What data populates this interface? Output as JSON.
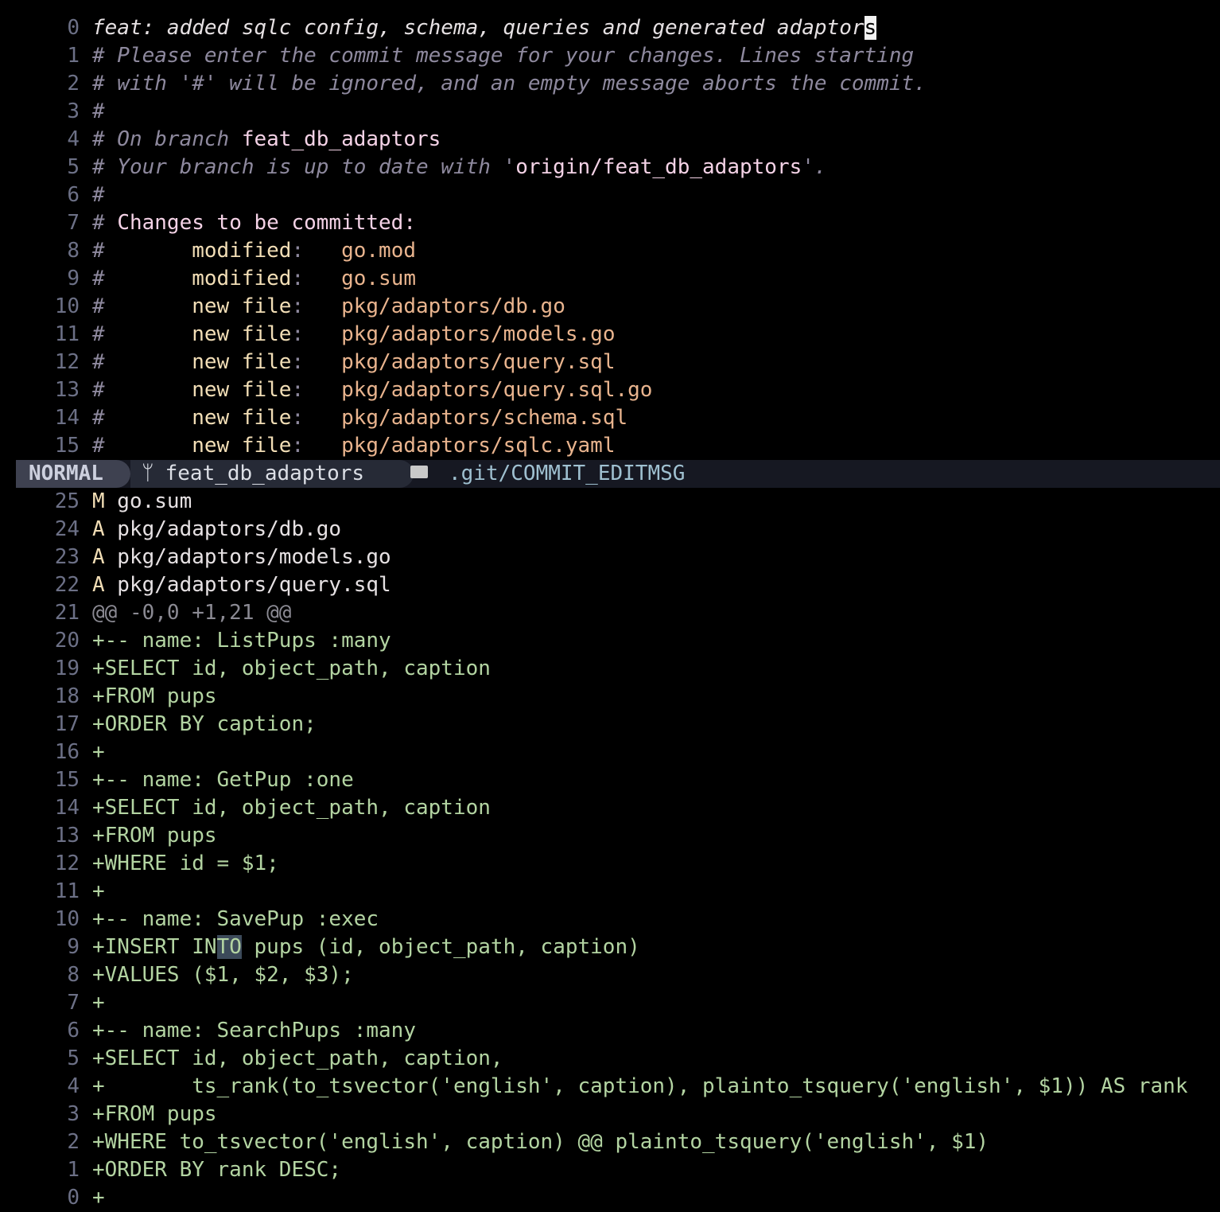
{
  "top_lines": [
    {
      "n": "0",
      "segs": [
        {
          "t": "feat: added sqlc config, schema, queries and generated adaptor",
          "c": "c-white it"
        },
        {
          "t": "s",
          "c": "cursor"
        }
      ]
    },
    {
      "n": "1",
      "segs": [
        {
          "t": "# Please enter the commit message for your changes. Lines starting",
          "c": "c-comment it"
        }
      ]
    },
    {
      "n": "2",
      "segs": [
        {
          "t": "# with '#' will be ignored, and an empty message aborts the commit.",
          "c": "c-comment it"
        }
      ]
    },
    {
      "n": "3",
      "segs": [
        {
          "t": "#",
          "c": "c-comment it"
        }
      ]
    },
    {
      "n": "4",
      "segs": [
        {
          "t": "# On branch ",
          "c": "c-comment it"
        },
        {
          "t": "feat_db_adaptors",
          "c": "c-pink"
        }
      ]
    },
    {
      "n": "5",
      "segs": [
        {
          "t": "# Your branch is up to date with '",
          "c": "c-comment it"
        },
        {
          "t": "origin/feat_db_adaptors",
          "c": "c-pink"
        },
        {
          "t": "'.",
          "c": "c-comment it"
        }
      ]
    },
    {
      "n": "6",
      "segs": [
        {
          "t": "#",
          "c": "c-comment it"
        }
      ]
    },
    {
      "n": "7",
      "segs": [
        {
          "t": "# ",
          "c": "c-comment it"
        },
        {
          "t": "Changes to be committed:",
          "c": "c-pink"
        }
      ]
    },
    {
      "n": "8",
      "segs": [
        {
          "t": "#       ",
          "c": "c-comment it"
        },
        {
          "t": "modified",
          "c": "c-yellow"
        },
        {
          "t": ":   ",
          "c": "c-comment"
        },
        {
          "t": "go.mod",
          "c": "c-orange"
        }
      ]
    },
    {
      "n": "9",
      "segs": [
        {
          "t": "#       ",
          "c": "c-comment it"
        },
        {
          "t": "modified",
          "c": "c-yellow"
        },
        {
          "t": ":   ",
          "c": "c-comment"
        },
        {
          "t": "go.sum",
          "c": "c-orange"
        }
      ]
    },
    {
      "n": "10",
      "segs": [
        {
          "t": "#       ",
          "c": "c-comment it"
        },
        {
          "t": "new file",
          "c": "c-yellow"
        },
        {
          "t": ":   ",
          "c": "c-comment"
        },
        {
          "t": "pkg/adaptors/db.go",
          "c": "c-orange"
        }
      ]
    },
    {
      "n": "11",
      "segs": [
        {
          "t": "#       ",
          "c": "c-comment it"
        },
        {
          "t": "new file",
          "c": "c-yellow"
        },
        {
          "t": ":   ",
          "c": "c-comment"
        },
        {
          "t": "pkg/adaptors/models.go",
          "c": "c-orange"
        }
      ]
    },
    {
      "n": "12",
      "segs": [
        {
          "t": "#       ",
          "c": "c-comment it"
        },
        {
          "t": "new file",
          "c": "c-yellow"
        },
        {
          "t": ":   ",
          "c": "c-comment"
        },
        {
          "t": "pkg/adaptors/query.sql",
          "c": "c-orange"
        }
      ]
    },
    {
      "n": "13",
      "segs": [
        {
          "t": "#       ",
          "c": "c-comment it"
        },
        {
          "t": "new file",
          "c": "c-yellow"
        },
        {
          "t": ":   ",
          "c": "c-comment"
        },
        {
          "t": "pkg/adaptors/query.sql.go",
          "c": "c-orange"
        }
      ]
    },
    {
      "n": "14",
      "segs": [
        {
          "t": "#       ",
          "c": "c-comment it"
        },
        {
          "t": "new file",
          "c": "c-yellow"
        },
        {
          "t": ":   ",
          "c": "c-comment"
        },
        {
          "t": "pkg/adaptors/schema.sql",
          "c": "c-orange"
        }
      ]
    },
    {
      "n": "15",
      "segs": [
        {
          "t": "#       ",
          "c": "c-comment it"
        },
        {
          "t": "new file",
          "c": "c-yellow"
        },
        {
          "t": ":   ",
          "c": "c-comment"
        },
        {
          "t": "pkg/adaptors/sqlc.yaml",
          "c": "c-orange"
        }
      ]
    }
  ],
  "statusline": {
    "mode": "NORMAL",
    "branch_icon": "git-branch-icon",
    "branch": "feat_db_adaptors",
    "folder_icon": "folder-icon",
    "file": ".git/COMMIT_EDITMSG"
  },
  "bottom_lines": [
    {
      "n": "25",
      "segs": [
        {
          "t": "M",
          "c": "c-yellow"
        },
        {
          "t": " go.sum",
          "c": "c-white"
        }
      ]
    },
    {
      "n": "24",
      "segs": [
        {
          "t": "A",
          "c": "c-yellow"
        },
        {
          "t": " pkg/adaptors/db.go",
          "c": "c-white"
        }
      ]
    },
    {
      "n": "23",
      "segs": [
        {
          "t": "A",
          "c": "c-yellow"
        },
        {
          "t": " pkg/adaptors/models.go",
          "c": "c-white"
        }
      ]
    },
    {
      "n": "22",
      "segs": [
        {
          "t": "A",
          "c": "c-yellow"
        },
        {
          "t": " pkg/adaptors/query.sql",
          "c": "c-white"
        }
      ]
    },
    {
      "n": "21",
      "segs": [
        {
          "t": "@@ -0,0 +1,21 @@",
          "c": "c-gray"
        }
      ]
    },
    {
      "n": "20",
      "segs": [
        {
          "t": "+-- name: ListPups :many",
          "c": "c-green"
        }
      ]
    },
    {
      "n": "19",
      "segs": [
        {
          "t": "+SELECT id, object_path, caption",
          "c": "c-green"
        }
      ]
    },
    {
      "n": "18",
      "segs": [
        {
          "t": "+FROM pups",
          "c": "c-green"
        }
      ]
    },
    {
      "n": "17",
      "segs": [
        {
          "t": "+ORDER BY caption;",
          "c": "c-green"
        }
      ]
    },
    {
      "n": "16",
      "segs": [
        {
          "t": "+",
          "c": "c-green"
        }
      ]
    },
    {
      "n": "15",
      "segs": [
        {
          "t": "+-- name: GetPup :one",
          "c": "c-green"
        }
      ]
    },
    {
      "n": "14",
      "segs": [
        {
          "t": "+SELECT id, object_path, caption",
          "c": "c-green"
        }
      ]
    },
    {
      "n": "13",
      "segs": [
        {
          "t": "+FROM pups",
          "c": "c-green"
        }
      ]
    },
    {
      "n": "12",
      "segs": [
        {
          "t": "+WHERE id = $1;",
          "c": "c-green"
        }
      ]
    },
    {
      "n": "11",
      "segs": [
        {
          "t": "+",
          "c": "c-green"
        }
      ]
    },
    {
      "n": "10",
      "segs": [
        {
          "t": "+-- name: SavePup :exec",
          "c": "c-green"
        }
      ]
    },
    {
      "n": "9",
      "segs": [
        {
          "t": "+INSERT IN",
          "c": "c-green"
        },
        {
          "t": "TO",
          "c": "c-green hl"
        },
        {
          "t": " pups (id, object_path, caption)",
          "c": "c-green"
        }
      ]
    },
    {
      "n": "8",
      "segs": [
        {
          "t": "+VALUES ($1, $2, $3);",
          "c": "c-green"
        }
      ]
    },
    {
      "n": "7",
      "segs": [
        {
          "t": "+",
          "c": "c-green"
        }
      ]
    },
    {
      "n": "6",
      "segs": [
        {
          "t": "+-- name: SearchPups :many",
          "c": "c-green"
        }
      ]
    },
    {
      "n": "5",
      "segs": [
        {
          "t": "+SELECT id, object_path, caption,",
          "c": "c-green"
        }
      ]
    },
    {
      "n": "4",
      "segs": [
        {
          "t": "+       ts_rank(to_tsvector('english', caption), plainto_tsquery('english', $1)) AS rank",
          "c": "c-green"
        }
      ]
    },
    {
      "n": "3",
      "segs": [
        {
          "t": "+FROM pups",
          "c": "c-green"
        }
      ]
    },
    {
      "n": "2",
      "segs": [
        {
          "t": "+WHERE to_tsvector('english', caption) @@ plainto_tsquery('english', $1)",
          "c": "c-green"
        }
      ]
    },
    {
      "n": "1",
      "segs": [
        {
          "t": "+ORDER BY rank DESC;",
          "c": "c-green"
        }
      ]
    },
    {
      "n": "0",
      "segs": [
        {
          "t": "+",
          "c": "c-green"
        }
      ]
    }
  ]
}
